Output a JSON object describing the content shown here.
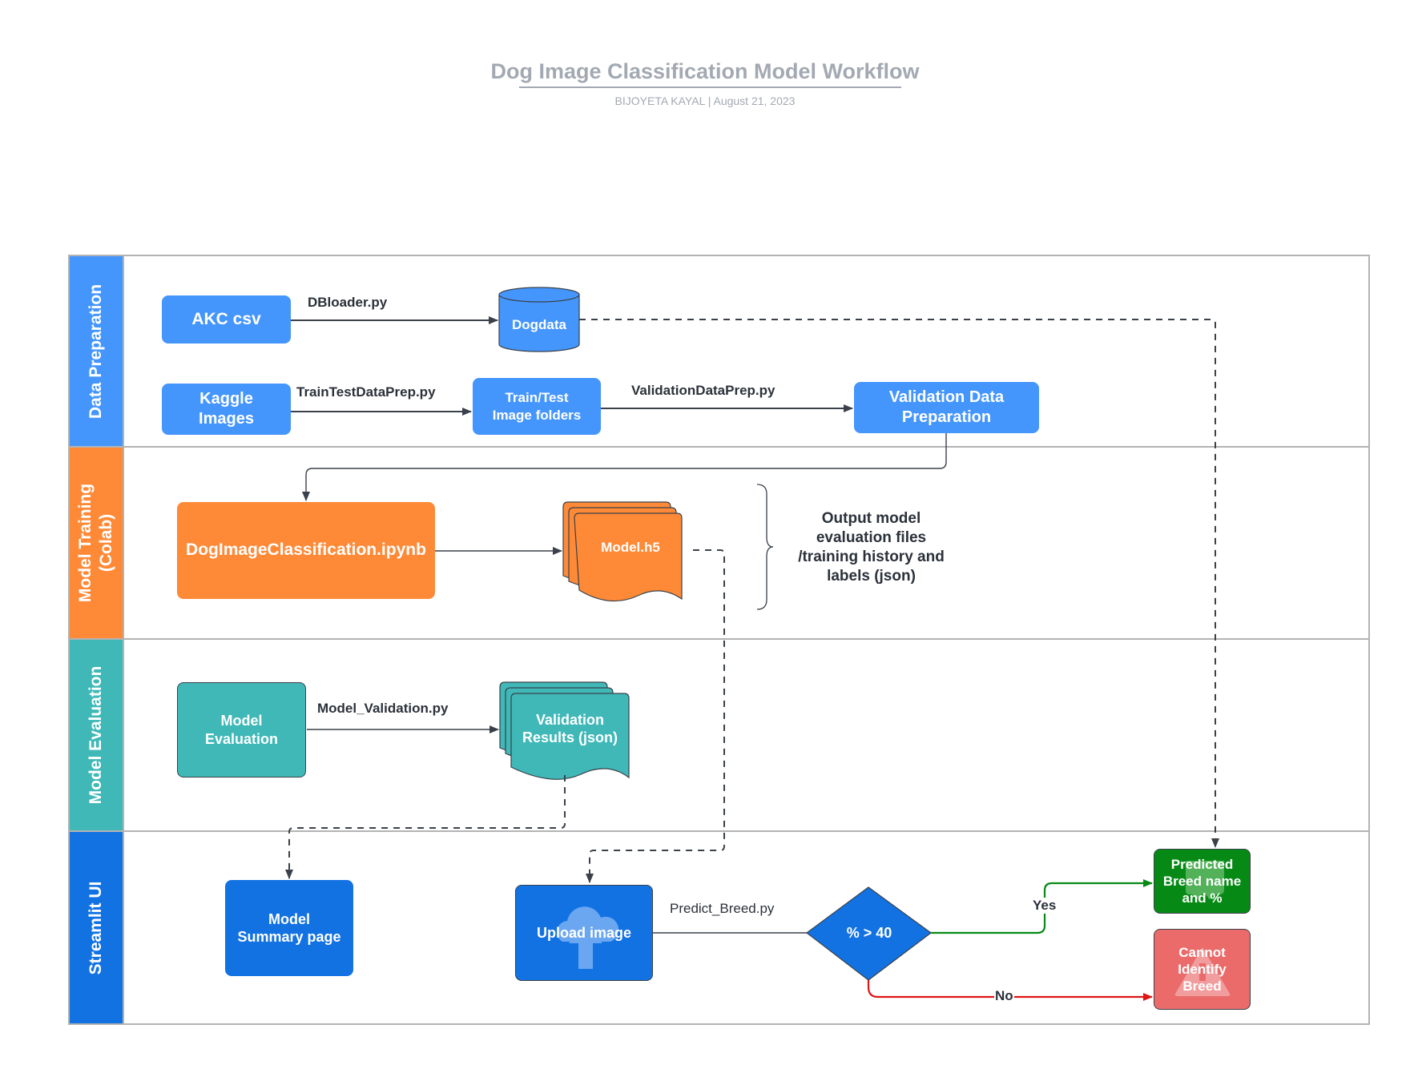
{
  "header": {
    "title": "Dog Image Classification Model Workflow",
    "subtitle": "BIJOYETA KAYAL  |  August 21, 2023"
  },
  "lanes": [
    {
      "label": "Data Preparation",
      "color": "#4596fc"
    },
    {
      "label": "Model Training\n(Colab)",
      "color": "#fe8a38"
    },
    {
      "label": "Model Evaluation",
      "color": "#3fb8b7"
    },
    {
      "label": "Streamlit UI",
      "color": "#1272e2"
    }
  ],
  "nodes": {
    "akc_csv": "AKC csv",
    "dogdata": "Dogdata",
    "kaggle_images": "Kaggle\nImages",
    "train_test_folders": "Train/Test\nImage folders",
    "validation_data_prep": "Validation Data\nPreparation",
    "notebook": "DogImageClassification.ipynb",
    "model_h5": "Model.h5",
    "model_evaluation": "Model\nEvaluation",
    "validation_results": "Validation\nResults (json)",
    "model_summary_page": "Model\nSummary page",
    "upload_image": "Upload image",
    "decision": "% > 40",
    "predicted_breed": "Predicted\nBreed name\nand %",
    "cannot_identify": "Cannot\nIdentify\nBreed"
  },
  "edges": {
    "dbloader": "DBloader.py",
    "train_test_prep": "TrainTestDataPrep.py",
    "validation_prep": "ValidationDataPrep.py",
    "model_validation": "Model_Validation.py",
    "predict_breed": "Predict_Breed.py",
    "yes": "Yes",
    "no": "No"
  },
  "annotation": "Output  model\nevaluation files\n/training history and\nlabels (json)",
  "colors": {
    "connector": "#3a414a",
    "yes_branch": "#068a15",
    "no_branch": "#e01515",
    "frame": "#b3b3b3",
    "title": "#a3a9b2"
  }
}
